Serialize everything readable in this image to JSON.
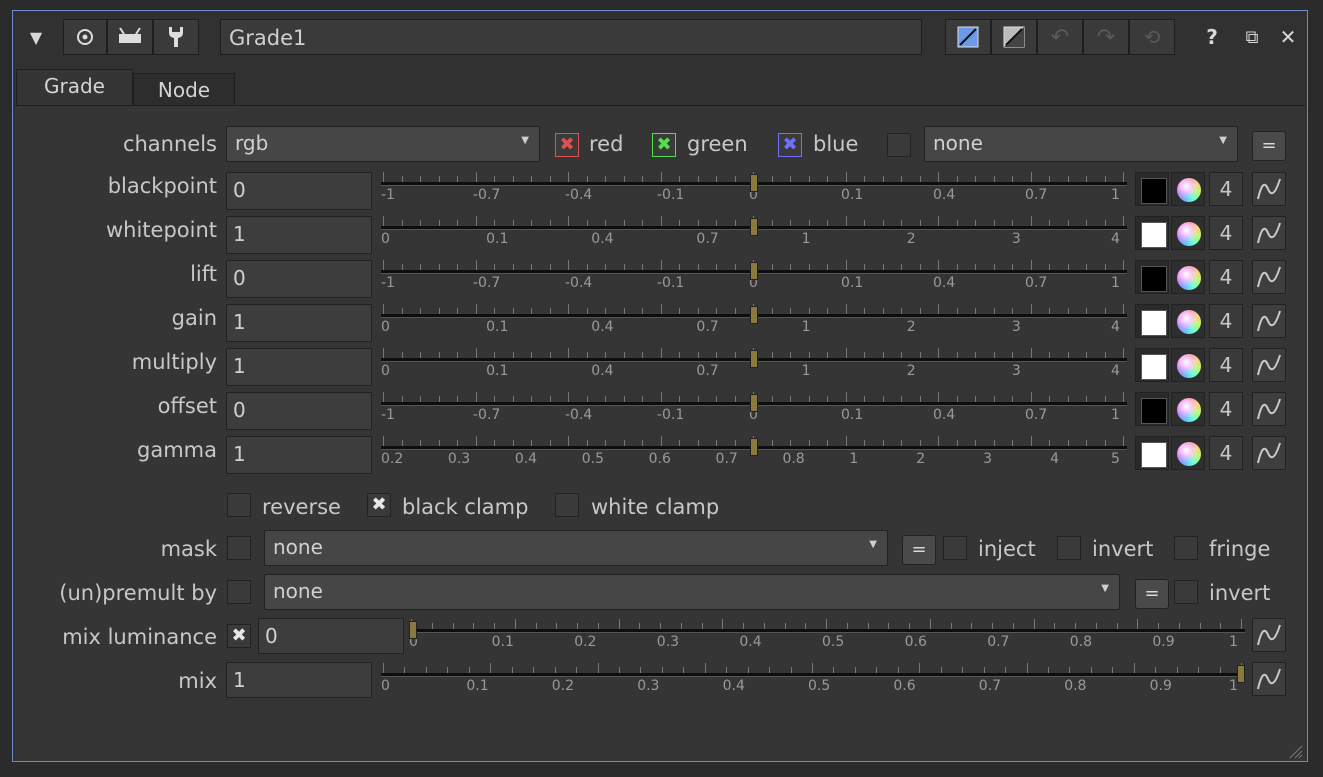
{
  "header": {
    "node_name": "Grade1",
    "icons": [
      "collapse-triangle-icon",
      "center-icon",
      "input-icon",
      "wrench-icon",
      "color-a-icon",
      "color-b-icon",
      "undo-icon",
      "redo-icon",
      "revert-icon",
      "help-icon",
      "float-icon",
      "close-icon"
    ]
  },
  "tabs": [
    {
      "label": "Grade",
      "active": true
    },
    {
      "label": "Node",
      "active": false
    }
  ],
  "channels": {
    "label": "channels",
    "value": "rgb",
    "red": {
      "label": "red",
      "checked": true,
      "color": "#e05050"
    },
    "green": {
      "label": "green",
      "checked": true,
      "color": "#50e050"
    },
    "blue": {
      "label": "blue",
      "checked": true,
      "color": "#6060f0"
    },
    "extra_checked": false,
    "extra_value": "none",
    "eq_label": "="
  },
  "params": [
    {
      "label": "blackpoint",
      "value": "0",
      "swatch": "#000000",
      "channels": "4",
      "ticks": [
        "-1",
        "-0.7",
        "-0.4",
        "-0.1",
        "0",
        "0.1",
        "0.4",
        "0.7",
        "1"
      ],
      "handle": 0.5
    },
    {
      "label": "whitepoint",
      "value": "1",
      "swatch": "#ffffff",
      "channels": "4",
      "ticks": [
        "0",
        "0.1",
        "0.4",
        "0.7",
        "1",
        "2",
        "3",
        "4"
      ],
      "handle": 0.5
    },
    {
      "label": "lift",
      "value": "0",
      "swatch": "#000000",
      "channels": "4",
      "ticks": [
        "-1",
        "-0.7",
        "-0.4",
        "-0.1",
        "0",
        "0.1",
        "0.4",
        "0.7",
        "1"
      ],
      "handle": 0.5
    },
    {
      "label": "gain",
      "value": "1",
      "swatch": "#ffffff",
      "channels": "4",
      "ticks": [
        "0",
        "0.1",
        "0.4",
        "0.7",
        "1",
        "2",
        "3",
        "4"
      ],
      "handle": 0.5
    },
    {
      "label": "multiply",
      "value": "1",
      "swatch": "#ffffff",
      "channels": "4",
      "ticks": [
        "0",
        "0.1",
        "0.4",
        "0.7",
        "1",
        "2",
        "3",
        "4"
      ],
      "handle": 0.5
    },
    {
      "label": "offset",
      "value": "0",
      "swatch": "#000000",
      "channels": "4",
      "ticks": [
        "-1",
        "-0.7",
        "-0.4",
        "-0.1",
        "0",
        "0.1",
        "0.4",
        "0.7",
        "1"
      ],
      "handle": 0.5
    },
    {
      "label": "gamma",
      "value": "1",
      "swatch": "#ffffff",
      "channels": "4",
      "ticks": [
        "0.2",
        "0.3",
        "0.4",
        "0.5",
        "0.6",
        "0.7",
        "0.8",
        "1",
        "2",
        "3",
        "4",
        "5"
      ],
      "handle": 0.5
    }
  ],
  "options": {
    "reverse": {
      "label": "reverse",
      "checked": false
    },
    "black_clamp": {
      "label": "black clamp",
      "checked": true
    },
    "white_clamp": {
      "label": "white clamp",
      "checked": false
    }
  },
  "mask": {
    "label": "mask",
    "checked": false,
    "value": "none",
    "eq_label": "=",
    "inject": {
      "label": "inject",
      "checked": false
    },
    "invert": {
      "label": "invert",
      "checked": false
    },
    "fringe": {
      "label": "fringe",
      "checked": false
    }
  },
  "premult": {
    "label": "(un)premult by",
    "checked": false,
    "value": "none",
    "eq_label": "=",
    "invert": {
      "label": "invert",
      "checked": false
    }
  },
  "mix_luminance": {
    "label": "mix luminance",
    "checked": true,
    "value": "0",
    "ticks": [
      "0",
      "0.1",
      "0.2",
      "0.3",
      "0.4",
      "0.5",
      "0.6",
      "0.7",
      "0.8",
      "0.9",
      "1"
    ],
    "handle": 0.0
  },
  "mix": {
    "label": "mix",
    "value": "1",
    "ticks": [
      "0",
      "0.1",
      "0.2",
      "0.3",
      "0.4",
      "0.5",
      "0.6",
      "0.7",
      "0.8",
      "0.9",
      "1"
    ],
    "handle": 1.0
  }
}
